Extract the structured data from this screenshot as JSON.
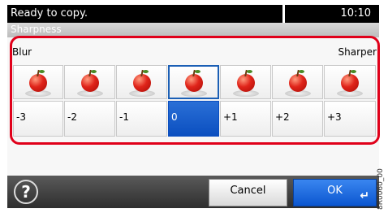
{
  "status": {
    "message": "Ready to copy.",
    "time": "10:10"
  },
  "screen_title": "Sharpness",
  "scale": {
    "left_label": "Blur",
    "right_label": "Sharper",
    "selected_value": "0",
    "options": [
      "-3",
      "-2",
      "-1",
      "0",
      "+1",
      "+2",
      "+3"
    ],
    "image_icon": "apple-icon"
  },
  "buttons": {
    "help_glyph": "?",
    "cancel": "Cancel",
    "ok": "OK"
  },
  "figure_code": "8R0060_00",
  "colors": {
    "selected_cell": "#0b4fc0",
    "highlight_frame": "#e0001a",
    "status_bar": "#000000"
  }
}
